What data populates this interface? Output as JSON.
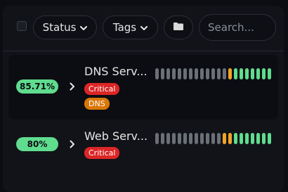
{
  "toolbar": {
    "filters": [
      {
        "label": "Status"
      },
      {
        "label": "Tags"
      }
    ],
    "folder_icon": "folder-icon",
    "search": {
      "placeholder": "Search...",
      "value": ""
    }
  },
  "colors": {
    "up": "#5fdc8e",
    "pending": "#f0a526",
    "empty": "#6b6f76",
    "critical": "#dc2626",
    "dns_tag": "#d97706"
  },
  "monitors": [
    {
      "uptime": "85.71%",
      "name": "DNS Serv...",
      "tags": [
        {
          "label": "Critical",
          "color": "#dc2626"
        },
        {
          "label": "DNS",
          "color": "#d97706"
        }
      ],
      "beats": [
        "empty",
        "empty",
        "empty",
        "empty",
        "empty",
        "empty",
        "empty",
        "empty",
        "empty",
        "empty",
        "empty",
        "empty",
        "empty",
        "pending",
        "up",
        "up",
        "up",
        "up",
        "up",
        "up",
        "up"
      ]
    },
    {
      "uptime": "80%",
      "name": "Web Serv...",
      "tags": [
        {
          "label": "Critical",
          "color": "#dc2626"
        }
      ],
      "beats": [
        "empty",
        "empty",
        "empty",
        "empty",
        "empty",
        "empty",
        "empty",
        "empty",
        "empty",
        "empty",
        "empty",
        "empty",
        "pending",
        "pending",
        "up",
        "up",
        "up",
        "up",
        "up",
        "up",
        "up"
      ]
    }
  ]
}
